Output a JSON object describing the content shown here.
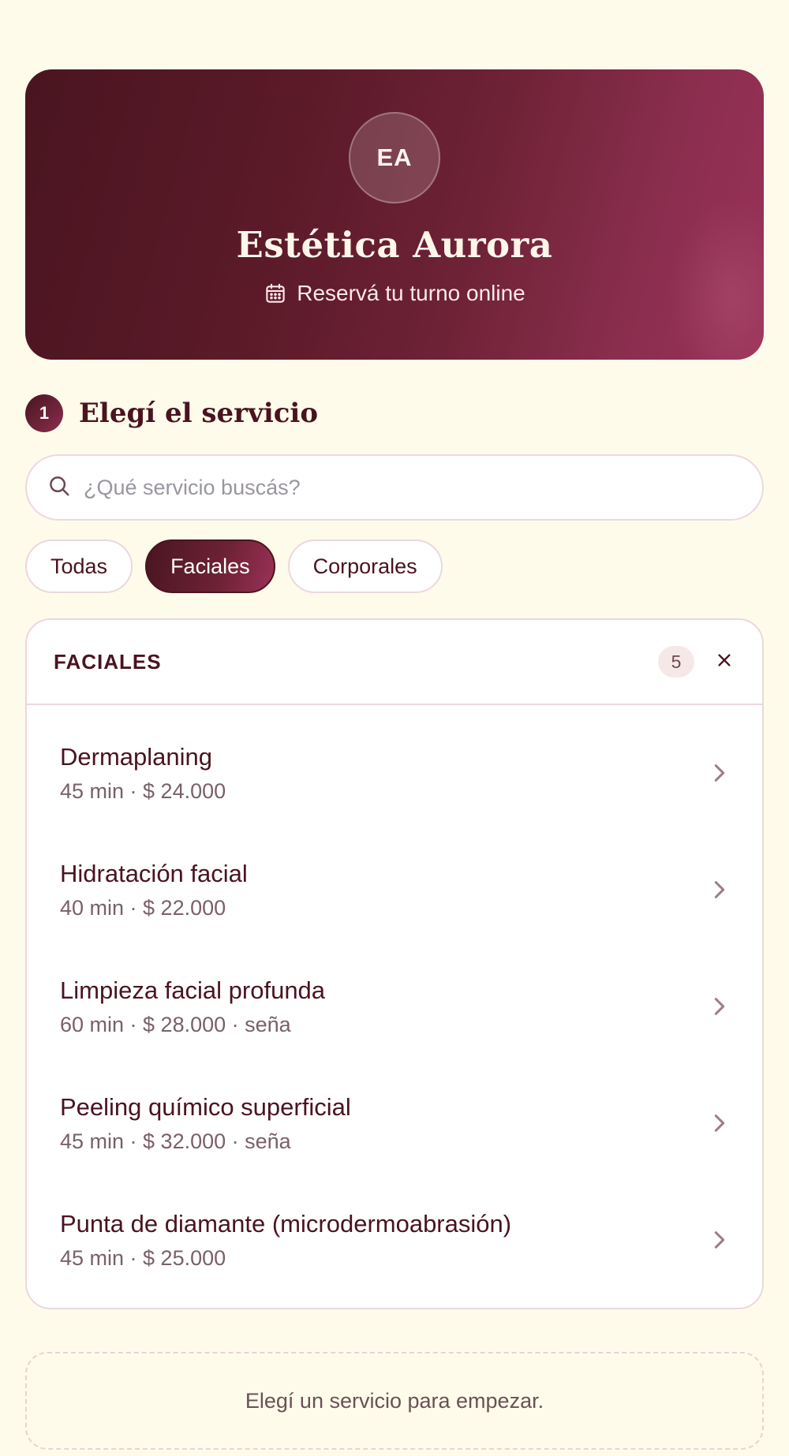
{
  "hero": {
    "avatar_initials": "EA",
    "title": "Estética Aurora",
    "subtitle": "Reservá tu turno online",
    "subtitle_icon": "calendar-icon"
  },
  "step": {
    "number": "1",
    "title": "Elegí el servicio"
  },
  "search": {
    "placeholder": "¿Qué servicio buscás?",
    "value": "",
    "icon": "search-icon"
  },
  "filters": [
    {
      "label": "Todas",
      "active": false
    },
    {
      "label": "Faciales",
      "active": true
    },
    {
      "label": "Corporales",
      "active": false
    }
  ],
  "category": {
    "title": "FACIALES",
    "count": "5",
    "close_icon": "close-icon"
  },
  "services": [
    {
      "name": "Dermaplaning",
      "meta": "45 min · $ 24.000"
    },
    {
      "name": "Hidratación facial",
      "meta": "40 min · $ 22.000"
    },
    {
      "name": "Limpieza facial profunda",
      "meta": "60 min · $ 28.000 · seña"
    },
    {
      "name": "Peeling químico superficial",
      "meta": "45 min · $ 32.000 · seña"
    },
    {
      "name": "Punta de diamante (microdermoabrasión)",
      "meta": "45 min · $ 25.000"
    }
  ],
  "hint": "Elegí un servicio para empezar.",
  "colors": {
    "background": "#fefbea",
    "brand_dark": "#4a1520",
    "brand_accent": "#9a3158",
    "text": "#4a1320"
  }
}
